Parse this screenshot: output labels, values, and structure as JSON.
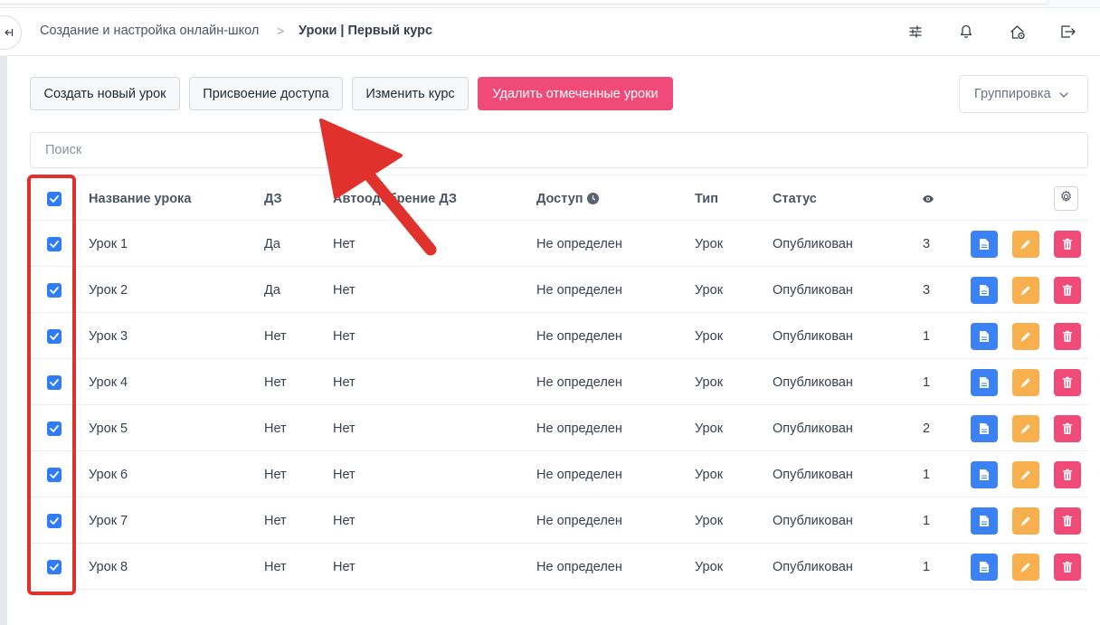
{
  "header": {
    "breadcrumb_parent": "Создание и настройка онлайн-школ",
    "breadcrumb_separator": ">",
    "breadcrumb_current": "Уроки | Первый курс",
    "icons": [
      "sliders-icon",
      "bell-icon",
      "home-settings-icon",
      "logout-icon"
    ]
  },
  "sidebar": {
    "collapse_icon": "collapse-sidebar-icon"
  },
  "toolbar": {
    "create_label": "Создать новый урок",
    "access_label": "Присвоение доступа",
    "edit_course_label": "Изменить курс",
    "delete_selected_label": "Удалить отмеченные уроки",
    "grouping_label": "Группировка"
  },
  "search": {
    "placeholder": "Поиск",
    "value": ""
  },
  "table": {
    "columns": {
      "name": "Название урока",
      "hw": "ДЗ",
      "auto_approve": "Автоодобрение ДЗ",
      "access": "Доступ",
      "type": "Тип",
      "status": "Статус",
      "views": "eye-icon",
      "settings": "gear-icon"
    },
    "header_checked": true,
    "rows": [
      {
        "checked": true,
        "name": "Урок 1",
        "hw": "Да",
        "auto_approve": "Нет",
        "access": "Не определен",
        "type": "Урок",
        "status": "Опубликован",
        "views": "3"
      },
      {
        "checked": true,
        "name": "Урок 2",
        "hw": "Да",
        "auto_approve": "Нет",
        "access": "Не определен",
        "type": "Урок",
        "status": "Опубликован",
        "views": "3"
      },
      {
        "checked": true,
        "name": "Урок 3",
        "hw": "Нет",
        "auto_approve": "Нет",
        "access": "Не определен",
        "type": "Урок",
        "status": "Опубликован",
        "views": "1"
      },
      {
        "checked": true,
        "name": "Урок 4",
        "hw": "Нет",
        "auto_approve": "Нет",
        "access": "Не определен",
        "type": "Урок",
        "status": "Опубликован",
        "views": "1"
      },
      {
        "checked": true,
        "name": "Урок 5",
        "hw": "Нет",
        "auto_approve": "Нет",
        "access": "Не определен",
        "type": "Урок",
        "status": "Опубликован",
        "views": "2"
      },
      {
        "checked": true,
        "name": "Урок 6",
        "hw": "Нет",
        "auto_approve": "Нет",
        "access": "Не определен",
        "type": "Урок",
        "status": "Опубликован",
        "views": "1"
      },
      {
        "checked": true,
        "name": "Урок 7",
        "hw": "Нет",
        "auto_approve": "Нет",
        "access": "Не определен",
        "type": "Урок",
        "status": "Опубликован",
        "views": "1"
      },
      {
        "checked": true,
        "name": "Урок 8",
        "hw": "Нет",
        "auto_approve": "Нет",
        "access": "Не определен",
        "type": "Урок",
        "status": "Опубликован",
        "views": "1"
      }
    ],
    "row_actions": [
      "document-icon",
      "pencil-icon",
      "trash-icon"
    ]
  },
  "colors": {
    "primary_blue": "#3b82f6",
    "edit_orange": "#f8b04e",
    "danger_pink": "#ef4a78",
    "annotation_red": "#e0312d"
  }
}
